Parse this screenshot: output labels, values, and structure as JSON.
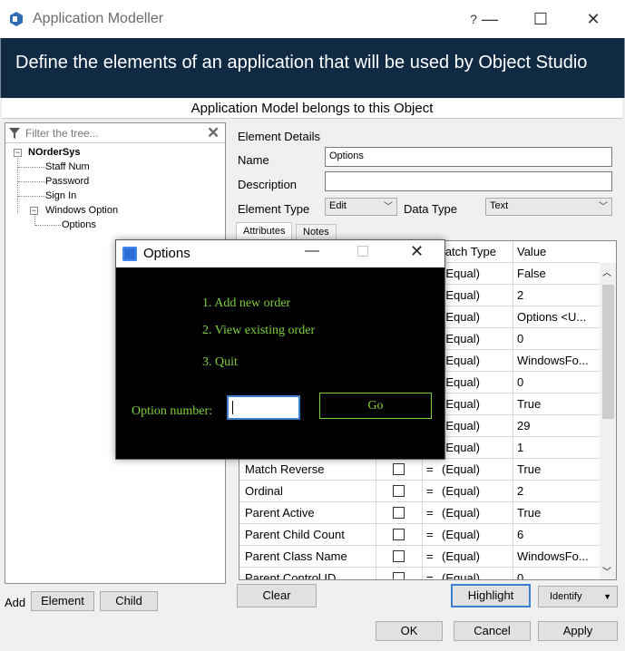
{
  "window": {
    "title": "Application Modeller",
    "help": "?",
    "minimize": "—",
    "maximize": "☐",
    "close": "✕"
  },
  "banner": {
    "text": "Define the elements of an application that will be used by Object Studio"
  },
  "subtitle": "Application Model belongs to this Object",
  "tree": {
    "filter_placeholder": "Filter the tree...",
    "nodes": [
      "NOrderSys",
      "Staff Num",
      "Password",
      "Sign In",
      "Windows Option",
      "Options"
    ]
  },
  "add": {
    "label": "Add",
    "element_button": "Element",
    "child_button": "Child"
  },
  "details": {
    "heading": "Element Details",
    "name_label": "Name",
    "name_value": "Options",
    "description_label": "Description",
    "description_value": "",
    "element_type_label": "Element Type",
    "element_type_value": "Edit",
    "data_type_label": "Data Type",
    "data_type_value": "Text"
  },
  "tabs": [
    "Attributes",
    "Notes"
  ],
  "grid": {
    "header_match": "Match Type",
    "header_value": "Value",
    "rows": [
      {
        "name": "",
        "match": "(Equal)",
        "value": "False"
      },
      {
        "name": "",
        "match": "(Equal)",
        "value": "2"
      },
      {
        "name": "",
        "match": "(Equal)",
        "value": "Options <U..."
      },
      {
        "name": "",
        "match": "(Equal)",
        "value": "0"
      },
      {
        "name": "",
        "match": "(Equal)",
        "value": "WindowsFo..."
      },
      {
        "name": "",
        "match": "(Equal)",
        "value": "0"
      },
      {
        "name": "",
        "match": "(Equal)",
        "value": "True"
      },
      {
        "name": "",
        "match": "(Equal)",
        "value": "29"
      },
      {
        "name": "",
        "match": "(Equal)",
        "value": "1"
      },
      {
        "name": "Match Reverse",
        "match": "(Equal)",
        "value": "True"
      },
      {
        "name": "Ordinal",
        "match": "(Equal)",
        "value": "2"
      },
      {
        "name": "Parent Active",
        "match": "(Equal)",
        "value": "True"
      },
      {
        "name": "Parent Child Count",
        "match": "(Equal)",
        "value": "6"
      },
      {
        "name": "Parent Class Name",
        "match": "(Equal)",
        "value": "WindowsFo..."
      },
      {
        "name": "Parent Control ID",
        "match": "(Equal)",
        "value": "0"
      }
    ],
    "eq_sign": "="
  },
  "actions": {
    "clear": "Clear",
    "highlight": "Highlight",
    "identify": "Identify"
  },
  "footer": {
    "ok": "OK",
    "cancel": "Cancel",
    "apply": "Apply"
  },
  "options_window": {
    "title": "Options",
    "menu": [
      "1. Add new order",
      "2. View existing order",
      "3. Quit"
    ],
    "option_label": "Option number:",
    "option_value": "",
    "go_label": "Go"
  },
  "colors": {
    "banner": "#102a44",
    "console_text": "#7fd13b",
    "console_bg": "#000000",
    "accent": "#3a7fd0"
  }
}
